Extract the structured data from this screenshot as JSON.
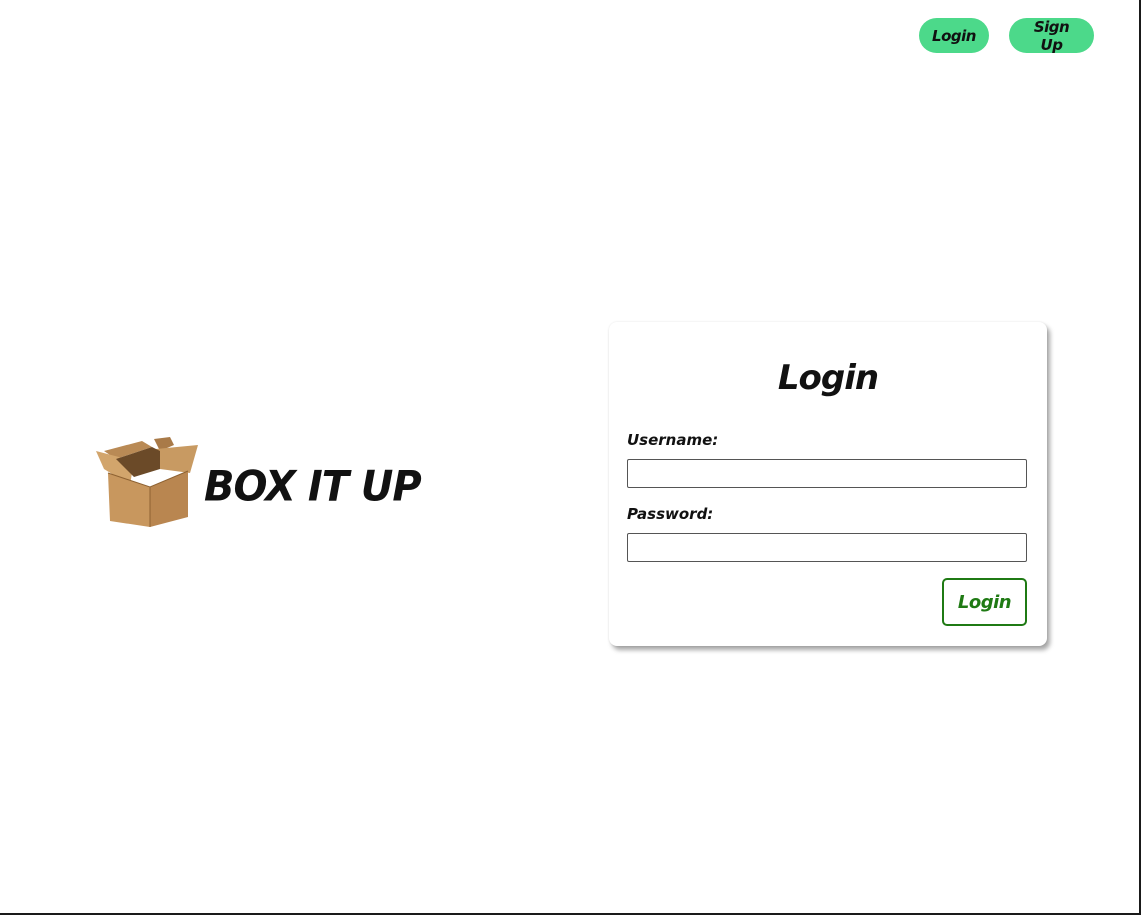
{
  "nav": {
    "login_label": "Login",
    "signup_label": "Sign Up"
  },
  "brand": {
    "name": "BOX IT UP",
    "logo_icon": "cardboard-box-icon"
  },
  "login_form": {
    "title": "Login",
    "username_label": "Username:",
    "username_value": "",
    "password_label": "Password:",
    "password_value": "",
    "submit_label": "Login"
  },
  "colors": {
    "pill_bg": "#4cd98a",
    "submit_accent": "#1f7a14",
    "box_brown": "#c89a62"
  }
}
